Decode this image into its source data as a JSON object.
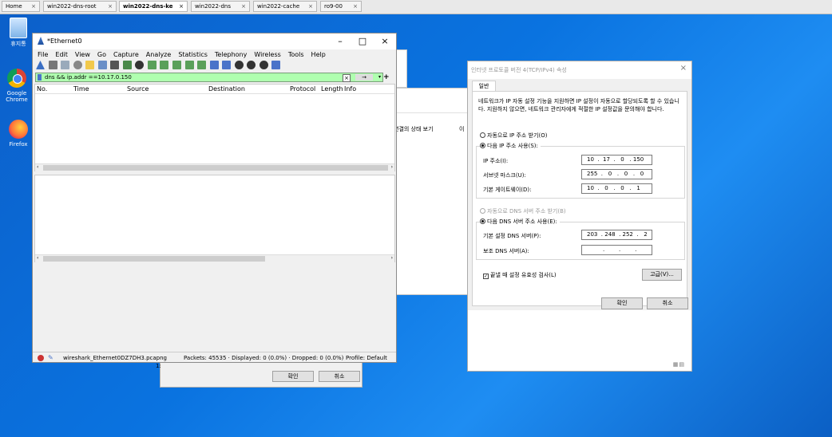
{
  "browser_tabs": [
    {
      "label": "Home",
      "active": false
    },
    {
      "label": "win2022-dns-root",
      "active": false
    },
    {
      "label": "win2022-dns-ke",
      "active": true
    },
    {
      "label": "win2022-dns",
      "active": false
    },
    {
      "label": "win2022-cache",
      "active": false
    },
    {
      "label": "ro9-00",
      "active": false
    }
  ],
  "desktop_icons": [
    {
      "label": "휴지통",
      "icon": "recycle-bin-icon"
    },
    {
      "label": "Google Chrome",
      "icon": "chrome-icon"
    },
    {
      "label": "Firefox",
      "icon": "firefox-icon"
    }
  ],
  "background_windows": {
    "status_link": "연결의 상태 보기",
    "status_link2": "이",
    "ok_label": "확인",
    "cancel_label": "취소",
    "small_text": "1:"
  },
  "wireshark": {
    "title": "*Ethernet0",
    "menu": [
      "File",
      "Edit",
      "View",
      "Go",
      "Capture",
      "Analyze",
      "Statistics",
      "Telephony",
      "Wireless",
      "Tools",
      "Help"
    ],
    "filter": "dns && ip.addr ==10.17.0.150",
    "filter_color": "#afffaf",
    "columns": [
      "No.",
      "Time",
      "Source",
      "Destination",
      "Protocol",
      "Length",
      "Info"
    ],
    "status_file": "wireshark_Ethernet0DZ7DH3.pcapng",
    "status_packets": "Packets: 45535 · Displayed: 0 (0.0%) · Dropped: 0 (0.0%)",
    "status_profile": "Profile: Default"
  },
  "ipv4_dialog": {
    "title": "인터넷 프로토콜 버전 4(TCP/IPv4) 속성",
    "tab": "일반",
    "description": "네트워크가 IP 자동 설정 기능을 지원하면 IP 설정이 자동으로 할당되도록 할 수 있습니다. 지원하지 않으면, 네트워크 관리자에게 적절한 IP 설정값을 문의해야 합니다.",
    "auto_ip": "자동으로 IP 주소 받기(O)",
    "manual_ip": "다음 IP 주소 사용(S):",
    "ip_label": "IP 주소(I):",
    "ip_value": "10  .  17  .   0   . 150",
    "subnet_label": "서브넷 마스크(U):",
    "subnet_value": "255  .   0   .   0   .   0",
    "gateway_label": "기본 게이트웨이(D):",
    "gateway_value": "10  .   0   .   0   .   1",
    "auto_dns": "자동으로 DNS 서버 주소 받기(B)",
    "manual_dns": "다음 DNS 서버 주소 사용(E):",
    "pref_dns_label": "기본 설정 DNS 서버(P):",
    "pref_dns_value": "203  . 248  . 252  .   2",
    "alt_dns_label": "보조 DNS 서버(A):",
    "alt_dns_value": "         .        .        .",
    "validate_label": "끝낼 때 설정 유효성 검사(L)",
    "advanced_label": "고급(V)...",
    "ok_label": "확인",
    "cancel_label": "취소"
  }
}
